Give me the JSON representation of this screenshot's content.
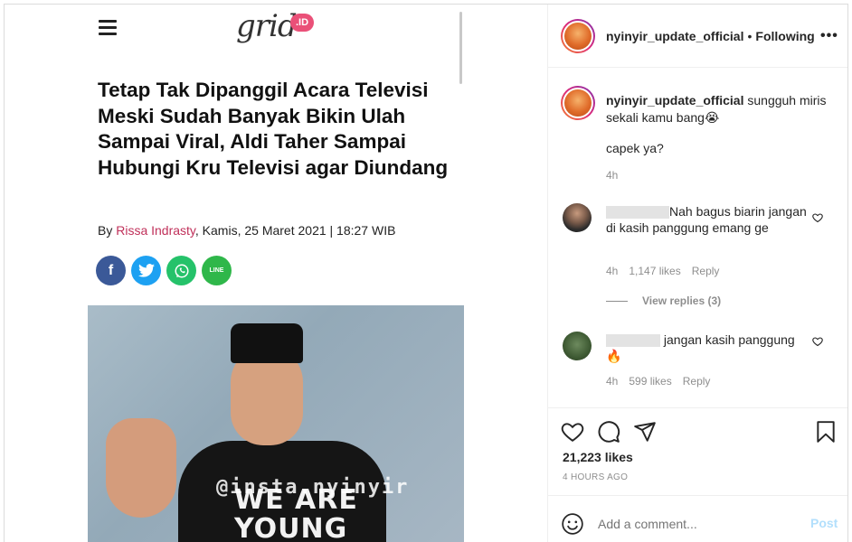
{
  "article": {
    "logo_text": "grid",
    "logo_badge": ".ID",
    "headline": "Tetap Tak Dipanggil Acara Televisi Meski Sudah Banyak Bikin Ulah Sampai Viral, Aldi Taher Sampai Hubungi Kru Televisi agar Diundang",
    "by": "By ",
    "author": "Rissa Indrasty",
    "date": ", Kamis, 25 Maret 2021 | 18:27 WIB",
    "share_icons": [
      "facebook-icon",
      "twitter-icon",
      "whatsapp-icon",
      "line-icon"
    ],
    "share_fb": "f",
    "share_line": "LINE",
    "photo_watermark": "@insta.nyinyir",
    "shirt_line1": "WE ARE",
    "shirt_line2": "YOUNG"
  },
  "post": {
    "username": "nyinyir_update_official",
    "separator": "•",
    "follow_status": "Following",
    "more": "•••",
    "caption_text": " sungguh miris sekali kamu bang😭",
    "caption_line2": "capek ya?",
    "caption_time": "4h"
  },
  "comments": [
    {
      "text": "Nah bagus biarin jangan di kasih panggung emang ge",
      "time": "4h",
      "likes": "1,147 likes",
      "reply": "Reply"
    },
    {
      "text": " jangan kasih panggung 🔥",
      "time": "4h",
      "likes": "599 likes",
      "reply": "Reply"
    }
  ],
  "view_replies": "View replies (3)",
  "likes_count": "21,223 likes",
  "posted_ago": "4 HOURS AGO",
  "add_comment": {
    "placeholder": "Add a comment...",
    "post_label": "Post"
  },
  "colors": {
    "author": "#c0305a",
    "post_disabled": "#b2dffc",
    "meta": "#8e8e8e"
  }
}
